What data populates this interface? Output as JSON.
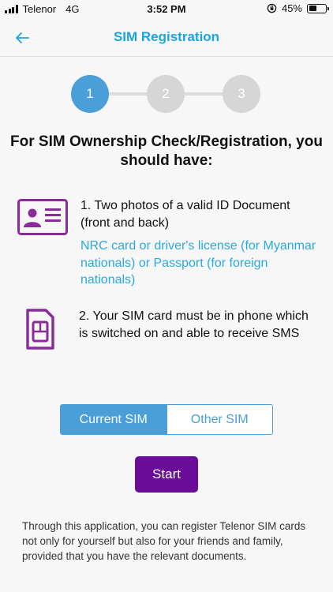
{
  "status_bar": {
    "carrier": "Telenor",
    "network": "4G",
    "time": "3:52 PM",
    "battery": "45%",
    "battery_level": 0.45
  },
  "nav": {
    "title": "SIM Registration",
    "back_icon": "arrow-left-icon"
  },
  "stepper": {
    "steps": [
      "1",
      "2",
      "3"
    ],
    "current": 1
  },
  "heading": "For SIM Ownership Check/Registration, you should have:",
  "requirements": [
    {
      "icon": "id-card-icon",
      "text": "1. Two photos of a valid ID Document (front and back)",
      "subtext": "NRC card or driver's license (for Myanmar nationals) or Passport (for foreign nationals)"
    },
    {
      "icon": "sim-card-icon",
      "text": "2. Your SIM card must be in phone which is switched on and able to receive SMS"
    }
  ],
  "sim_toggle": {
    "options": [
      "Current SIM",
      "Other SIM"
    ],
    "selected": "Current SIM"
  },
  "start_button": "Start",
  "footer": "Through this application, you can register Telenor SIM cards not only for yourself but also for your friends and family, provided that you have the relevant documents.",
  "colors": {
    "accent": "#4a9fd9",
    "title": "#1aa5e0",
    "purple": "#6b0d99",
    "icon_purple": "#8a2a9b"
  }
}
